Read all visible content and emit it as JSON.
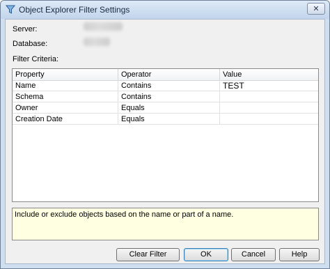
{
  "window": {
    "title": "Object Explorer Filter Settings",
    "close_glyph": "✕"
  },
  "fields": {
    "server_label": "Server:",
    "database_label": "Database:",
    "filter_criteria_label": "Filter Criteria:"
  },
  "grid": {
    "columns": [
      "Property",
      "Operator",
      "Value"
    ],
    "rows": [
      {
        "property": "Name",
        "operator": "Contains",
        "value": "TEST"
      },
      {
        "property": "Schema",
        "operator": "Contains",
        "value": ""
      },
      {
        "property": "Owner",
        "operator": "Equals",
        "value": ""
      },
      {
        "property": "Creation Date",
        "operator": "Equals",
        "value": ""
      }
    ]
  },
  "description": "Include or exclude objects based on the name or part of a name.",
  "buttons": {
    "clear_filter": "Clear Filter",
    "ok": "OK",
    "cancel": "Cancel",
    "help": "Help"
  },
  "icons": {
    "title": "filter-icon"
  },
  "colors": {
    "title_bar": "#c2d5ec",
    "description_background": "#ffffe1"
  }
}
